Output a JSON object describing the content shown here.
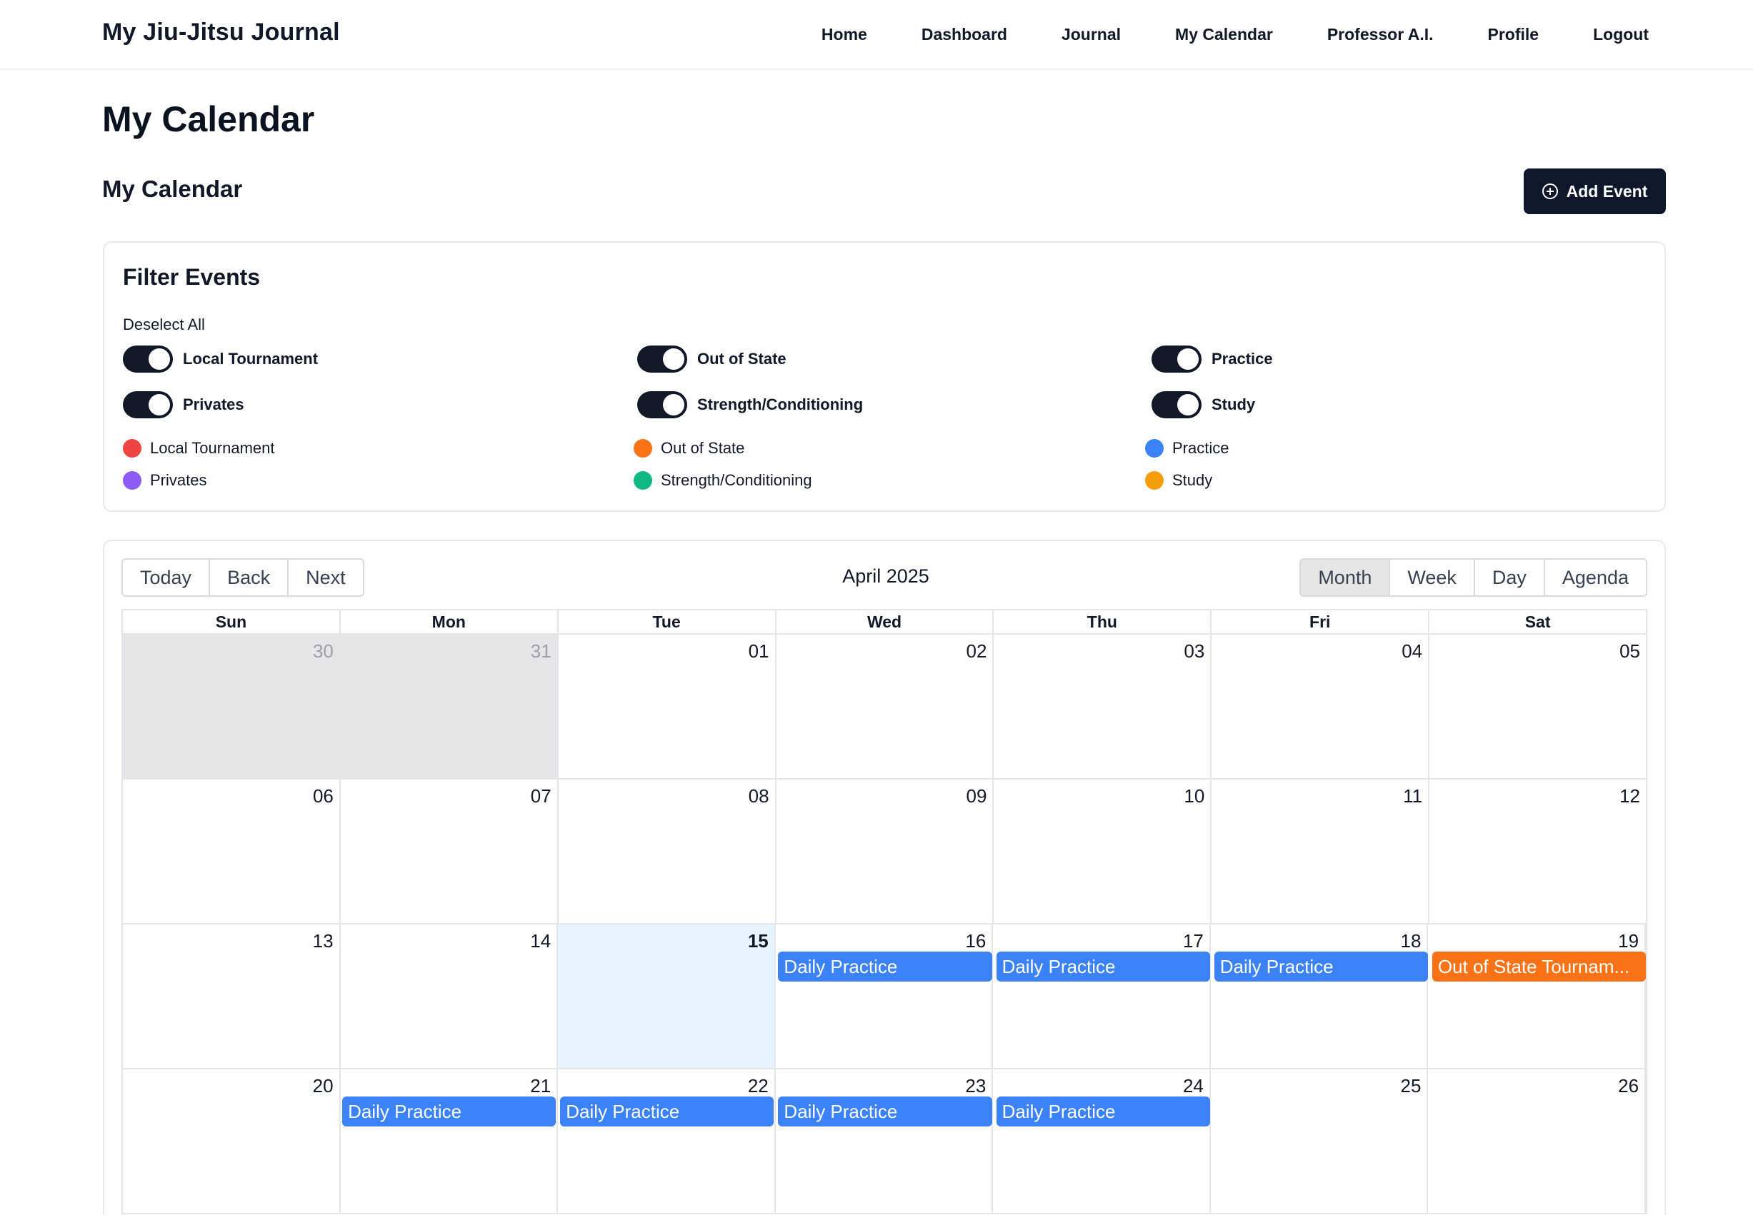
{
  "app": {
    "brand": "My Jiu-Jitsu Journal",
    "nav": [
      "Home",
      "Dashboard",
      "Journal",
      "My Calendar",
      "Professor A.I.",
      "Profile",
      "Logout"
    ]
  },
  "page": {
    "title": "My Calendar",
    "section_title": "My Calendar",
    "add_event_label": "Add Event"
  },
  "filter": {
    "title": "Filter Events",
    "deselect_label": "Deselect All",
    "toggles": [
      {
        "label": "Local Tournament",
        "on": true
      },
      {
        "label": "Out of State",
        "on": true
      },
      {
        "label": "Practice",
        "on": true
      },
      {
        "label": "Privates",
        "on": true
      },
      {
        "label": "Strength/Conditioning",
        "on": true
      },
      {
        "label": "Study",
        "on": true
      }
    ],
    "legend": [
      {
        "label": "Local Tournament",
        "color": "#ef4444"
      },
      {
        "label": "Out of State",
        "color": "#f97316"
      },
      {
        "label": "Practice",
        "color": "#3b82f6"
      },
      {
        "label": "Privates",
        "color": "#8b5cf6"
      },
      {
        "label": "Strength/Conditioning",
        "color": "#10b981"
      },
      {
        "label": "Study",
        "color": "#f59e0b"
      }
    ]
  },
  "calendar": {
    "toolbar_left": [
      "Today",
      "Back",
      "Next"
    ],
    "month_label": "April 2025",
    "views": [
      "Month",
      "Week",
      "Day",
      "Agenda"
    ],
    "active_view": "Month",
    "weekdays": [
      "Sun",
      "Mon",
      "Tue",
      "Wed",
      "Thu",
      "Fri",
      "Sat"
    ],
    "weeks": [
      [
        "30",
        "31",
        "01",
        "02",
        "03",
        "04",
        "05"
      ],
      [
        "06",
        "07",
        "08",
        "09",
        "10",
        "11",
        "12"
      ],
      [
        "13",
        "14",
        "15",
        "16",
        "17",
        "18",
        "19"
      ],
      [
        "20",
        "21",
        "22",
        "23",
        "24",
        "25",
        "26"
      ]
    ],
    "off_range_days": [
      "30",
      "31"
    ],
    "today": "15",
    "events": [
      {
        "title": "Daily Practice",
        "date": "16",
        "color": "#3b82f6"
      },
      {
        "title": "Daily Practice",
        "date": "17",
        "color": "#3b82f6"
      },
      {
        "title": "Daily Practice",
        "date": "18",
        "color": "#3b82f6"
      },
      {
        "title": "Out of State Tournam...",
        "date": "19",
        "color": "#f97316"
      },
      {
        "title": "Daily Practice",
        "date": "21",
        "color": "#3b82f6"
      },
      {
        "title": "Daily Practice",
        "date": "22",
        "color": "#3b82f6"
      },
      {
        "title": "Daily Practice",
        "date": "23",
        "color": "#3b82f6"
      },
      {
        "title": "Daily Practice",
        "date": "24",
        "color": "#3b82f6"
      }
    ]
  }
}
